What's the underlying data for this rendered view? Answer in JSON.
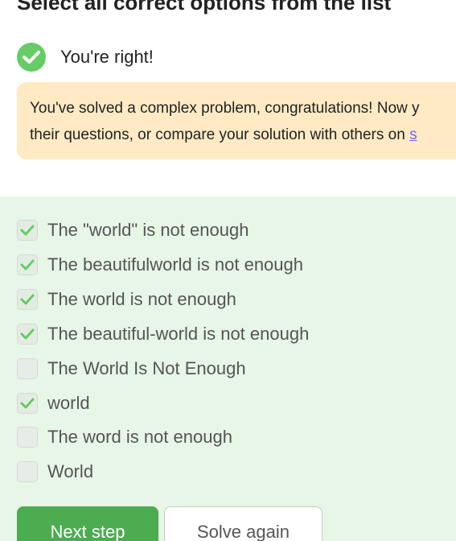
{
  "question": {
    "heading": "Select all correct options from the list"
  },
  "result": {
    "icon": "check-circle-icon",
    "text": "You're right!",
    "success_color": "#66cc66"
  },
  "notice": {
    "line1": "You've solved a complex problem, congratulations! Now y",
    "line2_prefix": "their questions, or compare your solution with others on ",
    "line2_link": "s",
    "background": "#ffeac4"
  },
  "options": [
    {
      "label": "The \"world\" is not enough",
      "checked": true
    },
    {
      "label": "The beautifulworld is not enough",
      "checked": true
    },
    {
      "label": "The world is not enough",
      "checked": true
    },
    {
      "label": "The beautiful-world is not enough",
      "checked": true
    },
    {
      "label": "The World Is Not Enough",
      "checked": false
    },
    {
      "label": "world",
      "checked": true
    },
    {
      "label": "The word is not enough",
      "checked": false
    },
    {
      "label": "World",
      "checked": false
    }
  ],
  "buttons": {
    "next": "Next step",
    "solve_again": "Solve again"
  },
  "colors": {
    "accent_green": "#4cac50",
    "panel_green": "#e7f6e6",
    "link": "#6c6cf0"
  }
}
